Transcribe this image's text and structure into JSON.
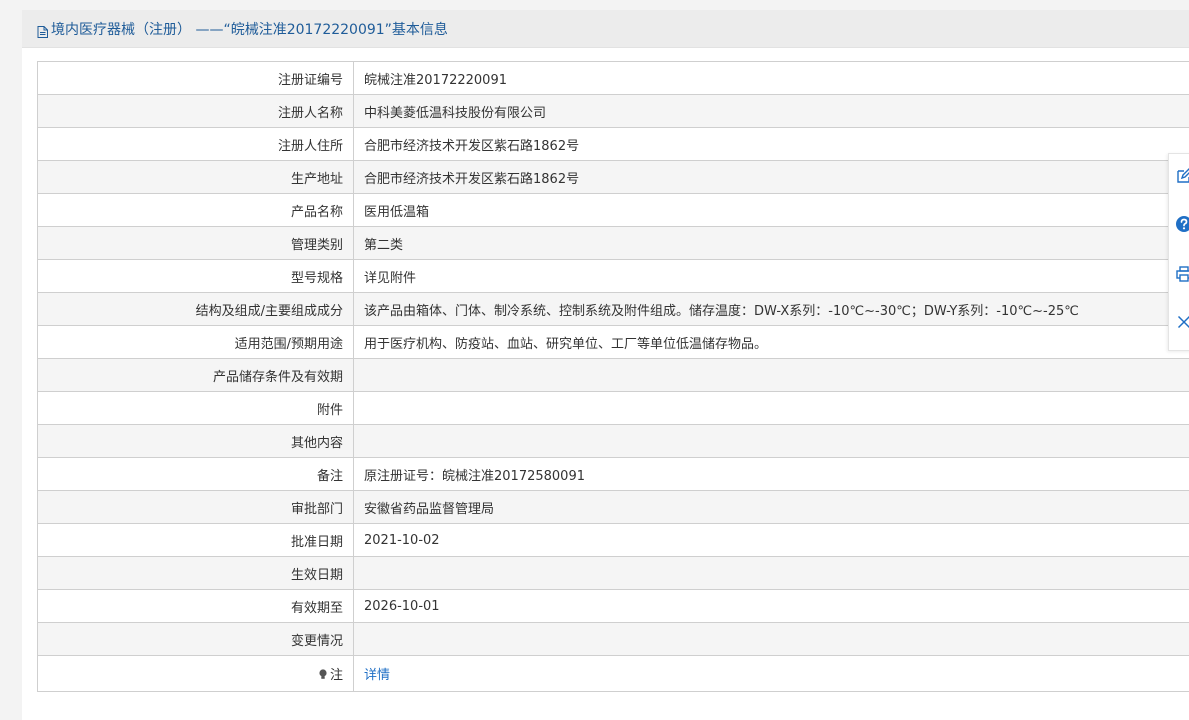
{
  "header": {
    "title": "境内医疗器械（注册） ——“皖械注准20172220091”基本信息"
  },
  "rows": [
    {
      "label": "注册证编号",
      "value": "皖械注准20172220091"
    },
    {
      "label": "注册人名称",
      "value": "中科美菱低温科技股份有限公司"
    },
    {
      "label": "注册人住所",
      "value": "合肥市经济技术开发区紫石路1862号"
    },
    {
      "label": "生产地址",
      "value": "合肥市经济技术开发区紫石路1862号"
    },
    {
      "label": "产品名称",
      "value": "医用低温箱"
    },
    {
      "label": "管理类别",
      "value": "第二类"
    },
    {
      "label": "型号规格",
      "value": "详见附件"
    },
    {
      "label": "结构及组成/主要组成成分",
      "value": "该产品由箱体、门体、制冷系统、控制系统及附件组成。储存温度：DW-X系列：-10℃~-30℃；DW-Y系列：-10℃~-25℃"
    },
    {
      "label": "适用范围/预期用途",
      "value": "用于医疗机构、防疫站、血站、研究单位、工厂等单位低温储存物品。"
    },
    {
      "label": "产品储存条件及有效期",
      "value": ""
    },
    {
      "label": "附件",
      "value": ""
    },
    {
      "label": "其他内容",
      "value": ""
    },
    {
      "label": "备注",
      "value": "原注册证号：皖械注准20172580091"
    },
    {
      "label": "审批部门",
      "value": "安徽省药品监督管理局"
    },
    {
      "label": "批准日期",
      "value": "2021-10-02"
    },
    {
      "label": "生效日期",
      "value": ""
    },
    {
      "label": "有效期至",
      "value": "2026-10-01"
    },
    {
      "label": "变更情况",
      "value": ""
    }
  ],
  "note_row": {
    "label": "注",
    "link": "详情"
  },
  "colors": {
    "title": "#1f5c99",
    "link": "#1f6fc5",
    "toolbar_icon": "#1f6fc5"
  },
  "toolbar": {
    "icons": [
      "edit-icon",
      "help-icon",
      "print-icon",
      "close-icon"
    ]
  }
}
